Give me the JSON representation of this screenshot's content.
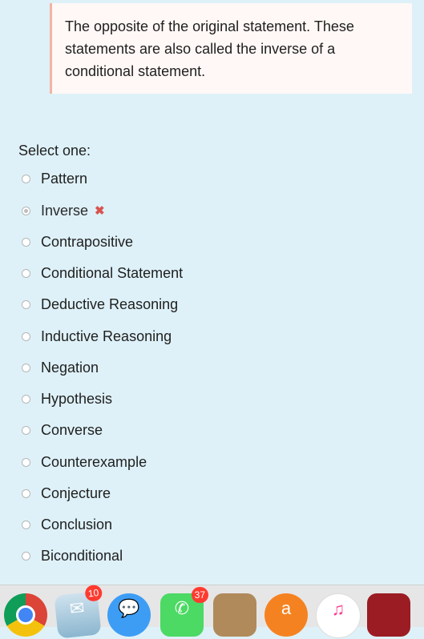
{
  "question": {
    "text": "The opposite of the original statement. These statements are also called the inverse of a conditional statement."
  },
  "select_prompt": "Select one:",
  "options": [
    {
      "label": "Pattern"
    },
    {
      "label": "Inverse"
    },
    {
      "label": "Contrapositive"
    },
    {
      "label": "Conditional Statement"
    },
    {
      "label": "Deductive Reasoning"
    },
    {
      "label": "Inductive Reasoning"
    },
    {
      "label": "Negation"
    },
    {
      "label": "Hypothesis"
    },
    {
      "label": "Converse"
    },
    {
      "label": "Counterexample"
    },
    {
      "label": "Conjecture"
    },
    {
      "label": "Conclusion"
    },
    {
      "label": "Biconditional"
    }
  ],
  "selected_option": "Inverse",
  "feedback": {
    "incorrect_mark": "✖",
    "incorrect_color": "#d9534f"
  },
  "dock": {
    "apps": [
      {
        "name": "chrome-icon"
      },
      {
        "name": "mail-icon",
        "badge": "10"
      },
      {
        "name": "messages-icon"
      },
      {
        "name": "facetime-icon",
        "badge": "37"
      },
      {
        "name": "contacts-icon"
      },
      {
        "name": "avast-icon"
      },
      {
        "name": "itunes-icon"
      },
      {
        "name": "photo-booth-icon"
      }
    ]
  }
}
